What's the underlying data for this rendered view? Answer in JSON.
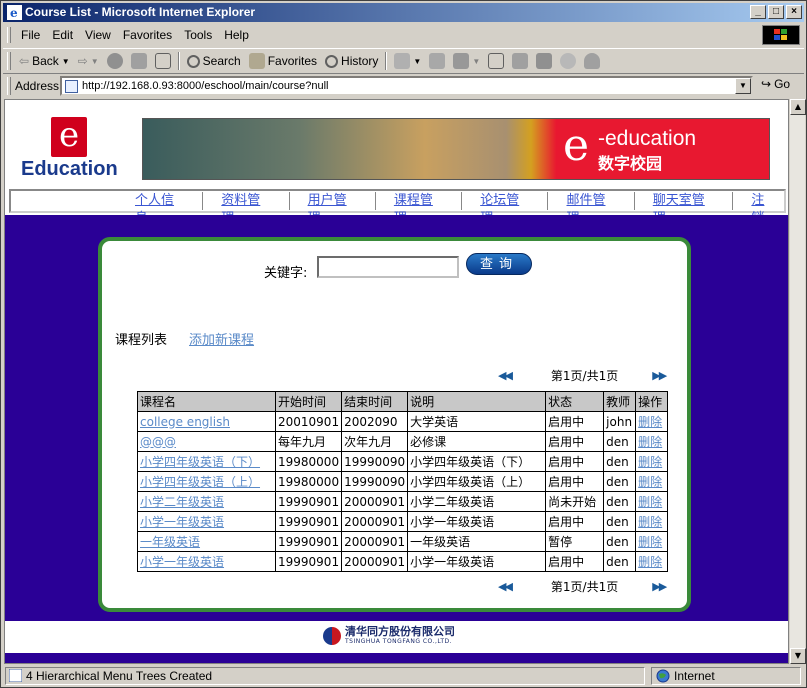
{
  "window": {
    "title": "Course List - Microsoft Internet Explorer"
  },
  "menu": {
    "items": [
      "File",
      "Edit",
      "View",
      "Favorites",
      "Tools",
      "Help"
    ]
  },
  "toolbar": {
    "back": "Back",
    "search": "Search",
    "favorites": "Favorites",
    "history": "History"
  },
  "address": {
    "label": "Address",
    "url": "http://192.168.0.93:8000/eschool/main/course?null",
    "go": "Go"
  },
  "header": {
    "logo_letter": "e",
    "logo_text": "Education",
    "banner_letter": "e",
    "banner_title": "-education",
    "banner_cn": "数字校园"
  },
  "nav": {
    "items": [
      "个人信息",
      "资料管理",
      "用户管理",
      "课程管理",
      "论坛管理",
      "邮件管理",
      "聊天室管理",
      "注销"
    ]
  },
  "search": {
    "label": "关键字:",
    "value": "",
    "button": "查询"
  },
  "list": {
    "title": "课程列表",
    "add_link": "添加新课程",
    "pager_text": "第1页/共1页",
    "headers": [
      "课程名",
      "开始时间",
      "结束时间",
      "说明",
      "状态",
      "教师",
      "操作"
    ],
    "rows": [
      {
        "name": "college english",
        "start": "20010901",
        "end": "2002090",
        "desc": "大学英语",
        "status": "启用中",
        "teacher": "john",
        "action": "删除"
      },
      {
        "name": "@@@",
        "start": "每年九月",
        "end": "次年九月",
        "desc": "必修课",
        "status": "启用中",
        "teacher": "den",
        "action": "删除"
      },
      {
        "name": "小学四年级英语（下）",
        "start": "19980000",
        "end": "19990090",
        "desc": "小学四年级英语（下）",
        "status": "启用中",
        "teacher": "den",
        "action": "删除"
      },
      {
        "name": "小学四年级英语（上）",
        "start": "19980000",
        "end": "19990090",
        "desc": "小学四年级英语（上）",
        "status": "启用中",
        "teacher": "den",
        "action": "删除"
      },
      {
        "name": "小学二年级英语",
        "start": "19990901",
        "end": "20000901",
        "desc": "小学二年级英语",
        "status": "尚未开始",
        "teacher": "den",
        "action": "删除"
      },
      {
        "name": "小学一年级英语",
        "start": "19990901",
        "end": "20000901",
        "desc": "小学一年级英语",
        "status": "启用中",
        "teacher": "den",
        "action": "删除"
      },
      {
        "name": "一年级英语",
        "start": "19990901",
        "end": "20000901",
        "desc": "一年级英语",
        "status": "暂停",
        "teacher": "den",
        "action": "删除"
      },
      {
        "name": "小学一年级英语",
        "start": "19990901",
        "end": "20000901",
        "desc": "小学一年级英语",
        "status": "启用中",
        "teacher": "den",
        "action": "删除"
      }
    ]
  },
  "footer": {
    "company_cn": "清华同方股份有限公司",
    "company_en": "TSINGHUA TONGFANG CO.,LTD."
  },
  "status": {
    "message": "4 Hierarchical Menu Trees Created",
    "zone": "Internet"
  },
  "colors": {
    "page_bg": "#2a0096",
    "panel_border": "#3a8a3a",
    "link": "#5a8ac8",
    "nav_link": "#3a56d2"
  }
}
